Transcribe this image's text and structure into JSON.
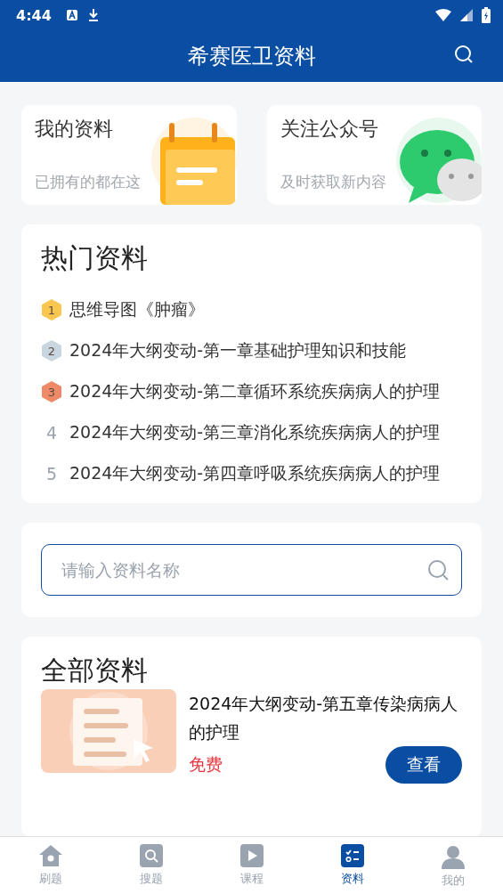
{
  "status_bar": {
    "time": "4:44"
  },
  "header": {
    "title": "希赛医卫资料"
  },
  "shortcuts": [
    {
      "kind": "calendar",
      "title": "我的资料",
      "subtitle": "已拥有的都在这"
    },
    {
      "kind": "chat",
      "title": "关注公众号",
      "subtitle": "及时获取新内容"
    }
  ],
  "hot": {
    "title": "热门资料",
    "items": [
      {
        "rank": "1",
        "kind": "badge",
        "color": "#f9c74f",
        "title": "思维导图《肿瘤》"
      },
      {
        "rank": "2",
        "kind": "badge",
        "color": "#c9d6e0",
        "title": "2024年大纲变动-第一章基础护理知识和技能"
      },
      {
        "rank": "3",
        "kind": "badge",
        "color": "#ef8a68",
        "title": "2024年大纲变动-第二章循环系统疾病病人的护理"
      },
      {
        "rank": "4",
        "kind": "plain",
        "title": "2024年大纲变动-第三章消化系统疾病病人的护理"
      },
      {
        "rank": "5",
        "kind": "plain",
        "title": "2024年大纲变动-第四章呼吸系统疾病病人的护理"
      }
    ]
  },
  "search": {
    "placeholder": "请输入资料名称"
  },
  "all": {
    "title": "全部资料",
    "items": [
      {
        "title": "2024年大纲变动-第五章传染病病人的护理",
        "price": "免费",
        "button": "查看"
      }
    ]
  },
  "tabs": [
    {
      "label": "刷题",
      "kind": "home",
      "selected": false
    },
    {
      "label": "搜题",
      "kind": "search",
      "selected": false
    },
    {
      "label": "课程",
      "kind": "play",
      "selected": false
    },
    {
      "label": "资料",
      "kind": "list",
      "selected": true
    },
    {
      "label": "我的",
      "kind": "person",
      "selected": false
    }
  ]
}
